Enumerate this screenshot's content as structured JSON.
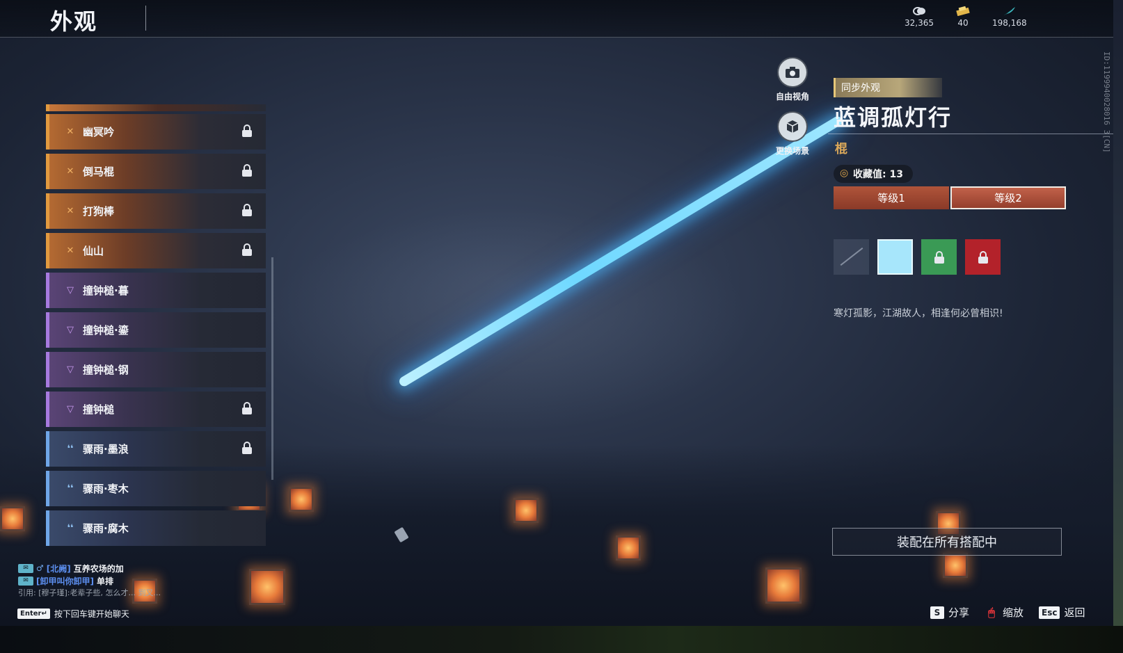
{
  "header": {
    "title": "外观",
    "currencies": [
      {
        "icon": "coin-icon",
        "value": "32,365"
      },
      {
        "icon": "ticket-icon",
        "value": "40"
      },
      {
        "icon": "feather-icon",
        "value": "198,168"
      }
    ]
  },
  "view_controls": {
    "free_camera": "自由视角",
    "change_scene": "更换场景"
  },
  "vertical_id": "ID:1199940028016 3[CN]",
  "item": {
    "sync_tag": "同步外观",
    "name": "蓝调孤灯行",
    "type": "棍",
    "collect_label": "收藏值: 13",
    "levels": [
      "等级1",
      "等级2"
    ],
    "selected_level": "等级2",
    "swatch_colors": [
      "#a7e6fb",
      "#3a9a55",
      "#b3222a"
    ],
    "description": "寒灯孤影，江湖故人，相逢何必曾相识!",
    "equip_all": "装配在所有搭配中"
  },
  "list": {
    "items": [
      {
        "name": "幽冥吟",
        "rarity": "orange",
        "locked": true
      },
      {
        "name": "倒马棍",
        "rarity": "orange",
        "locked": true
      },
      {
        "name": "打狗棒",
        "rarity": "orange",
        "locked": true
      },
      {
        "name": "仙山",
        "rarity": "orange",
        "locked": true
      },
      {
        "name": "撞钟槌·暮",
        "rarity": "purple",
        "locked": false
      },
      {
        "name": "撞钟槌·鎏",
        "rarity": "purple",
        "locked": false
      },
      {
        "name": "撞钟槌·钢",
        "rarity": "purple",
        "locked": false
      },
      {
        "name": "撞钟槌",
        "rarity": "purple",
        "locked": true
      },
      {
        "name": "骤雨·墨浪",
        "rarity": "blue",
        "locked": true
      },
      {
        "name": "骤雨·枣木",
        "rarity": "blue",
        "locked": false
      },
      {
        "name": "骤雨·腐木",
        "rarity": "blue",
        "locked": false
      }
    ]
  },
  "chat": {
    "line1_channel": "[北阙]",
    "line1_text": "互养农场的加",
    "line2_channel": "[卸甲叫你卸甲]",
    "line2_text": "单排",
    "quote": "引用: [穆子瑾]:老辈子些, 怎么才... 到又...",
    "hint_key": "Enter↵",
    "hint_text": "按下回车键开始聊天"
  },
  "hotkeys": [
    {
      "key": "S",
      "label": "分享"
    },
    {
      "key": "🖱",
      "label": "缩放"
    },
    {
      "key": "Esc",
      "label": "返回"
    }
  ]
}
